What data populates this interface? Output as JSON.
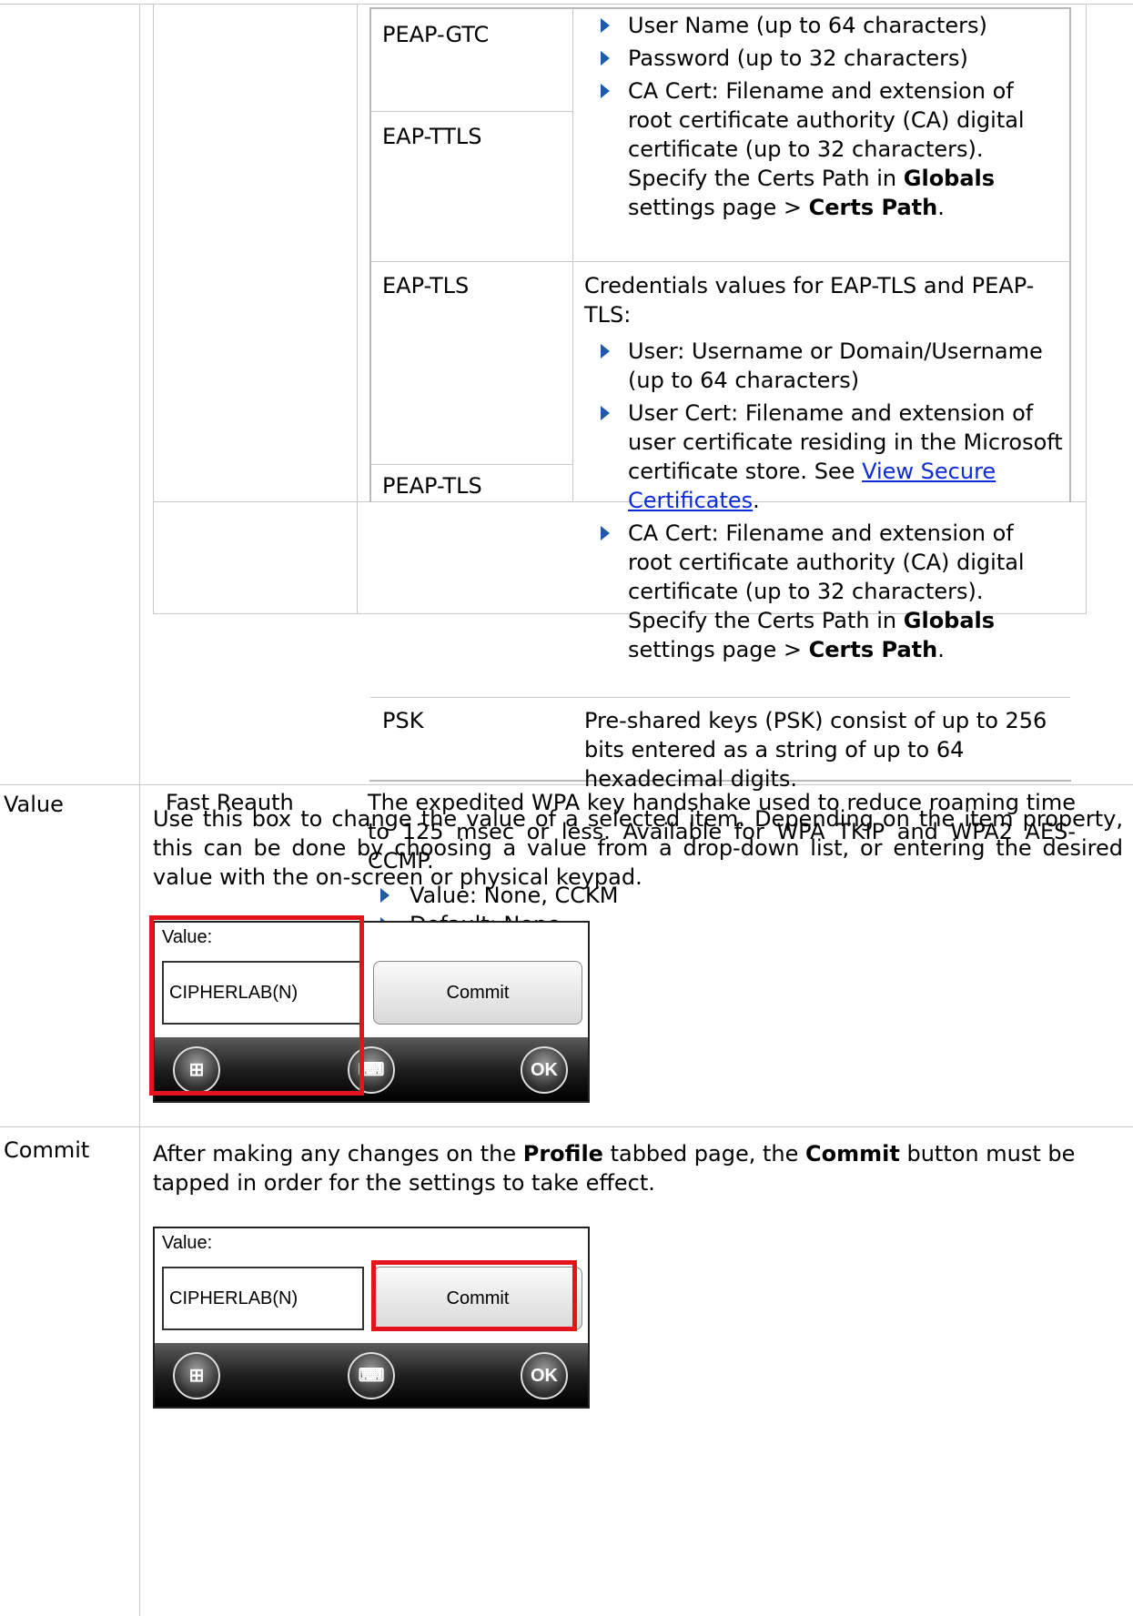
{
  "eap_rows": [
    {
      "type": "PEAP-GTC"
    },
    {
      "type": "EAP-TTLS"
    },
    {
      "type": "EAP-TLS"
    },
    {
      "type": "PEAP-TLS"
    },
    {
      "type": "PSK"
    }
  ],
  "gtc_ttls_desc": {
    "bullets": [
      "User Name (up to 64 characters)",
      "Password (up to 32 characters)"
    ],
    "ca_cert_1": "CA Cert: Filename and extension of root certificate authority (CA) digital certificate (up to 32 characters). Specify the Certs Path in ",
    "globals": "Globals",
    "ca_cert_2": " settings page > ",
    "certs_path": "Certs Path",
    "period": "."
  },
  "tls_desc": {
    "intro": "Credentials values for EAP-TLS and PEAP-TLS:",
    "user": "User: Username or Domain/Username (up to 64 characters)",
    "user_cert_1": "User Cert: Filename and extension of user certificate residing in the Microsoft certificate store. See ",
    "user_cert_link": "View Secure Certificates",
    "period": ".",
    "ca_cert_1": "CA Cert: Filename and extension of root certificate authority (CA) digital certificate (up to 32 characters). Specify the Certs Path in ",
    "globals": "Globals",
    "ca_cert_2": " settings page > ",
    "certs_path": "Certs Path"
  },
  "psk_desc": "Pre-shared keys (PSK) consist of up to 256 bits entered as a string of up to 64 hexadecimal digits.",
  "fast_reauth": {
    "label": "Fast Reauth",
    "desc": "The expedited WPA key handshake used to reduce roaming time to 125 msec or less. Available for WPA TKIP and WPA2 AES-CCMP.",
    "bullets": [
      "Value: None, CCKM",
      "Default: None"
    ]
  },
  "value_row": {
    "label": "Value",
    "desc": "Use this box to change the value of a selected item. Depending on the item property, this can be done by choosing a value from a drop-down list, or entering the desired value with the on-screen or physical keypad."
  },
  "commit_row": {
    "label": "Commit",
    "desc_1": "After making any changes on the ",
    "profile": "Profile",
    "desc_2": " tabbed page, the ",
    "commit": "Commit",
    "desc_3": " button must be tapped in order for the settings to take effect."
  },
  "device": {
    "value_label": "Value:",
    "value_text": "CIPHERLAB(N)",
    "commit_label": "Commit",
    "ok_label": "OK",
    "highlight_color": "#e3141b"
  }
}
